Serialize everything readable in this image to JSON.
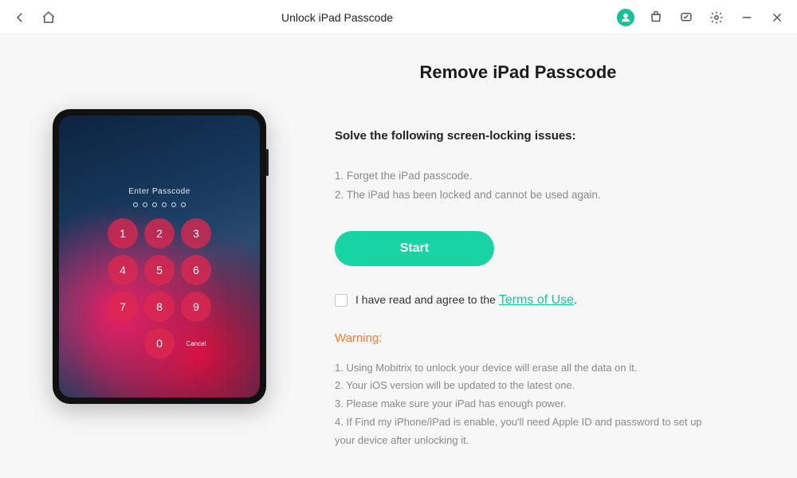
{
  "titlebar": {
    "title": "Unlock iPad Passcode"
  },
  "page": {
    "heading": "Remove iPad Passcode",
    "subheading": "Solve the following screen-locking issues:",
    "issues": [
      "1. Forget the iPad passcode.",
      "2. The iPad has been locked and cannot be used again."
    ],
    "start_label": "Start",
    "agree_prefix": "I have read and agree to the ",
    "terms_link": "Terms of Use",
    "agree_suffix": ".",
    "warning_label": "Warning:",
    "warnings": [
      "1. Using Mobitrix to unlock your device will erase all the data on it.",
      "2. Your iOS version will be updated to the latest one.",
      "3. Please make sure your iPad has enough power.",
      "4. If Find my iPhone/iPad is enable, you'll need Apple ID and password to set up your device after unlocking it."
    ]
  },
  "ipad": {
    "enter_label": "Enter Passcode",
    "keys": [
      "1",
      "2",
      "3",
      "4",
      "5",
      "6",
      "7",
      "8",
      "9",
      "",
      "0",
      ""
    ],
    "cancel_label": "Cancel"
  },
  "colors": {
    "accent": "#18d3a3",
    "warning": "#ff7a2e"
  }
}
